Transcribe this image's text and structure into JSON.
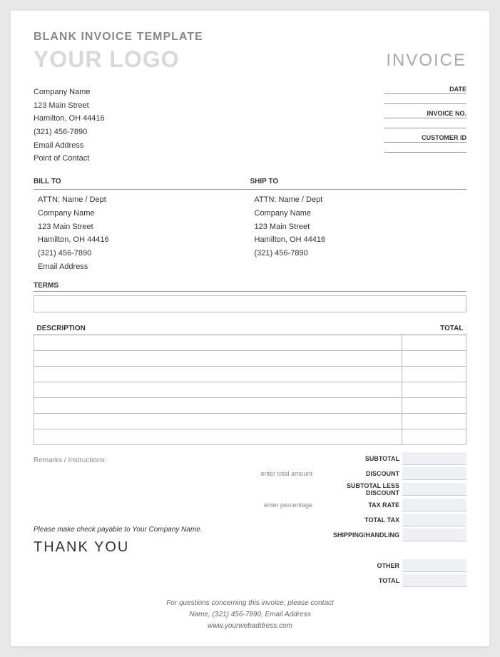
{
  "template_title": "BLANK INVOICE TEMPLATE",
  "logo_placeholder": "YOUR LOGO",
  "invoice_word": "INVOICE",
  "company": {
    "name": "Company Name",
    "street": "123 Main Street",
    "city_state_zip": "Hamilton, OH 44416",
    "phone": "(321) 456-7890",
    "email": "Email Address",
    "contact": "Point of Contact"
  },
  "meta": {
    "date_label": "DATE",
    "invoice_no_label": "INVOICE NO.",
    "customer_id_label": "CUSTOMER ID"
  },
  "bill_to": {
    "heading": "BILL TO",
    "attn": "ATTN: Name / Dept",
    "company": "Company Name",
    "street": "123 Main Street",
    "city_state_zip": "Hamilton, OH 44416",
    "phone": "(321) 456-7890",
    "email": "Email Address"
  },
  "ship_to": {
    "heading": "SHIP TO",
    "attn": "ATTN: Name / Dept",
    "company": "Company Name",
    "street": "123 Main Street",
    "city_state_zip": "Hamilton, OH 44416",
    "phone": "(321) 456-7890"
  },
  "terms_heading": "TERMS",
  "table": {
    "desc_header": "DESCRIPTION",
    "total_header": "TOTAL"
  },
  "remarks_label": "Remarks / Instructions:",
  "totals": {
    "subtotal": "SUBTOTAL",
    "discount_hint": "enter total amount",
    "discount": "DISCOUNT",
    "subtotal_less": "SUBTOTAL LESS DISCOUNT",
    "tax_rate_hint": "enter percentage",
    "tax_rate": "TAX RATE",
    "total_tax": "TOTAL TAX",
    "shipping": "SHIPPING/HANDLING",
    "other": "OTHER",
    "total": "TOTAL"
  },
  "payable_text": "Please make check payable to Your Company Name.",
  "thank_you": "THANK YOU",
  "footer": {
    "line1": "For questions concerning this invoice, please contact",
    "line2": "Name, (321) 456-7890, Email Address",
    "line3": "www.yourwebaddress.com"
  }
}
